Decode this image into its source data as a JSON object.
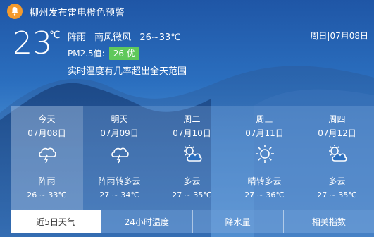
{
  "alert": {
    "text": "柳州发布雷电橙色预警",
    "icon": "alert-bell-icon",
    "color": "#f39a2c"
  },
  "current": {
    "temperature": "23",
    "unit": "℃",
    "weather": "阵雨",
    "wind": "南风微风",
    "range": "26~33℃",
    "date": "周日|07月08日",
    "pm_label": "PM2.5值:",
    "aqi_value": "26",
    "aqi_level": "优",
    "aqi_color": "#5fc85b",
    "notice": "实时温度有几率超出全天范围"
  },
  "forecast": [
    {
      "name": "今天",
      "date": "07月08日",
      "icon": "thunder-cloud-icon",
      "desc": "阵雨",
      "range": "26 ~ 33℃"
    },
    {
      "name": "明天",
      "date": "07月09日",
      "icon": "thunder-cloud-icon",
      "desc": "阵雨转多云",
      "range": "27 ~ 34℃"
    },
    {
      "name": "周二",
      "date": "07月10日",
      "icon": "partly-cloudy-icon",
      "desc": "多云",
      "range": "27 ~ 35℃"
    },
    {
      "name": "周三",
      "date": "07月11日",
      "icon": "sun-icon",
      "desc": "晴转多云",
      "range": "27 ~ 36℃"
    },
    {
      "name": "周四",
      "date": "07月12日",
      "icon": "partly-cloudy-icon",
      "desc": "多云",
      "range": "27 ~ 35℃"
    }
  ],
  "tabs": [
    "近5日天气",
    "24小时温度",
    "降水量",
    "相关指数"
  ]
}
